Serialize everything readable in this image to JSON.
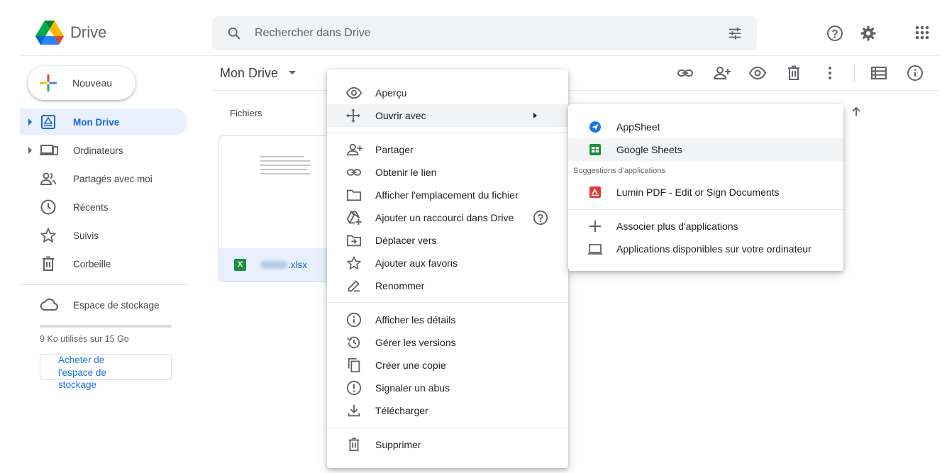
{
  "app": {
    "name": "Drive"
  },
  "search": {
    "placeholder": "Rechercher dans Drive",
    "value": ""
  },
  "header_icons": [
    "search-icon",
    "tune-icon",
    "help-icon",
    "settings-icon",
    "apps-grid-icon"
  ],
  "sidebar": {
    "new_label": "Nouveau",
    "items": [
      {
        "label": "Mon Drive",
        "icon": "my-drive-icon",
        "active": true,
        "expandable": true
      },
      {
        "label": "Ordinateurs",
        "icon": "computers-icon",
        "active": false,
        "expandable": true
      },
      {
        "label": "Partagés avec moi",
        "icon": "shared-icon",
        "active": false,
        "expandable": false
      },
      {
        "label": "Récents",
        "icon": "clock-icon",
        "active": false,
        "expandable": false
      },
      {
        "label": "Suivis",
        "icon": "star-icon",
        "active": false,
        "expandable": false
      },
      {
        "label": "Corbeille",
        "icon": "trash-icon",
        "active": false,
        "expandable": false
      }
    ],
    "storage_label": "Espace de stockage",
    "storage_used_text": "9 Ko utilisés sur 15 Go",
    "storage_fraction": 0.0,
    "buy_storage_label": "Acheter de l'espace de stockage"
  },
  "main": {
    "title": "Mon Drive",
    "section_label": "Fichiers",
    "toolbar_icons": [
      "link-icon",
      "add-person-icon",
      "preview-icon",
      "trash-icon",
      "more-vert-icon",
      "list-view-icon",
      "info-icon"
    ],
    "file": {
      "name_suffix": ".xlsx",
      "type_badge": "X"
    }
  },
  "context_menu": {
    "items": [
      {
        "label": "Aperçu",
        "icon": "eye-icon"
      },
      {
        "label": "Ouvrir avec",
        "icon": "open-with-icon",
        "highlighted": true,
        "has_submenu": true
      },
      {
        "label": "Partager",
        "icon": "add-person-icon"
      },
      {
        "label": "Obtenir le lien",
        "icon": "link-icon"
      },
      {
        "label": "Afficher l'emplacement du fichier",
        "icon": "folder-icon"
      },
      {
        "label": "Ajouter un raccourci dans Drive",
        "icon": "add-shortcut-icon",
        "help": true
      },
      {
        "label": "Déplacer vers",
        "icon": "move-to-folder-icon"
      },
      {
        "label": "Ajouter aux favoris",
        "icon": "star-icon"
      },
      {
        "label": "Renommer",
        "icon": "rename-icon"
      },
      {
        "label": "Afficher les détails",
        "icon": "info-icon"
      },
      {
        "label": "Gérer les versions",
        "icon": "history-icon"
      },
      {
        "label": "Créer une copie",
        "icon": "copy-icon"
      },
      {
        "label": "Signaler un abus",
        "icon": "report-icon"
      },
      {
        "label": "Télécharger",
        "icon": "download-icon"
      },
      {
        "label": "Supprimer",
        "icon": "trash-icon"
      }
    ]
  },
  "open_with_submenu": {
    "apps": [
      {
        "label": "AppSheet",
        "icon": "appsheet-icon"
      },
      {
        "label": "Google Sheets",
        "icon": "google-sheets-icon",
        "highlighted": true
      }
    ],
    "suggestions_caption": "Suggestions d'applications",
    "suggestions": [
      {
        "label": "Lumin PDF - Edit or Sign Documents",
        "icon": "lumin-pdf-icon"
      }
    ],
    "extra": [
      {
        "label": "Associer plus d'applications",
        "icon": "plus-icon"
      },
      {
        "label": "Applications disponibles sur votre ordinateur",
        "icon": "laptop-icon"
      }
    ]
  },
  "colors": {
    "accent": "#1a73e8",
    "active_nav_bg": "#e8f0fe",
    "sheets_green": "#1e8e3e",
    "lumin_red": "#e53935",
    "appsheet_blue": "#1a73e8"
  }
}
